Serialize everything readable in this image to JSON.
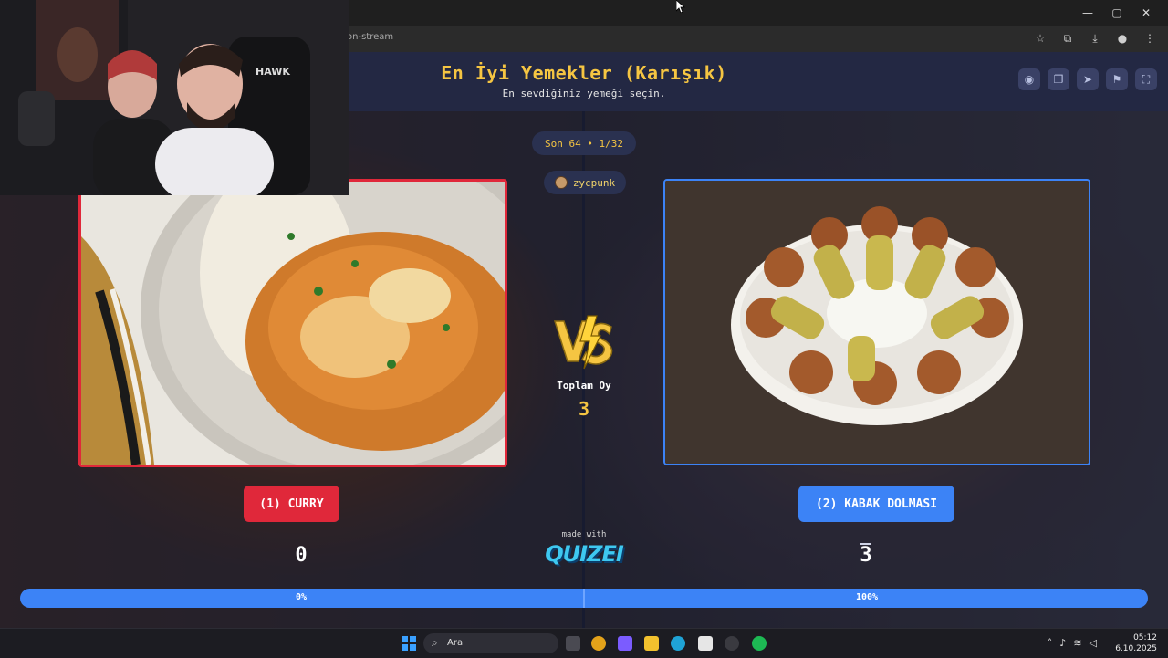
{
  "browser": {
    "url": "on-stream",
    "window_controls": [
      "—",
      "▢",
      "✕"
    ],
    "actions": [
      "star-icon",
      "extensions-icon",
      "download-icon",
      "profile-icon",
      "menu-icon"
    ]
  },
  "header": {
    "title": "En İyi Yemekler (Karışık)",
    "subtitle": "En sevdiğiniz yemeği seçin."
  },
  "header_actions": [
    "eye-icon",
    "copy-icon",
    "send-icon",
    "flag-icon",
    "fullscreen-icon"
  ],
  "round": {
    "label": "Son 64 • 1/32"
  },
  "user": {
    "name": "zycpunk"
  },
  "total_votes": {
    "label": "Toplam Oy",
    "value": "3"
  },
  "choices": [
    {
      "label": "(1) CURRY",
      "score": "0",
      "percent": "0%",
      "percent_value": 0,
      "color": "#e0283a"
    },
    {
      "label": "(2) KABAK DOLMASI",
      "score": "3",
      "percent": "100%",
      "percent_value": 100,
      "color": "#3c83f6"
    }
  ],
  "footer": {
    "made_with": "made with",
    "brand": "QUIZEI"
  },
  "taskbar": {
    "search_placeholder": "Ara",
    "time": "05:12",
    "date": "6.10.2025"
  },
  "webcam": {
    "logo_text": "HAWK"
  }
}
